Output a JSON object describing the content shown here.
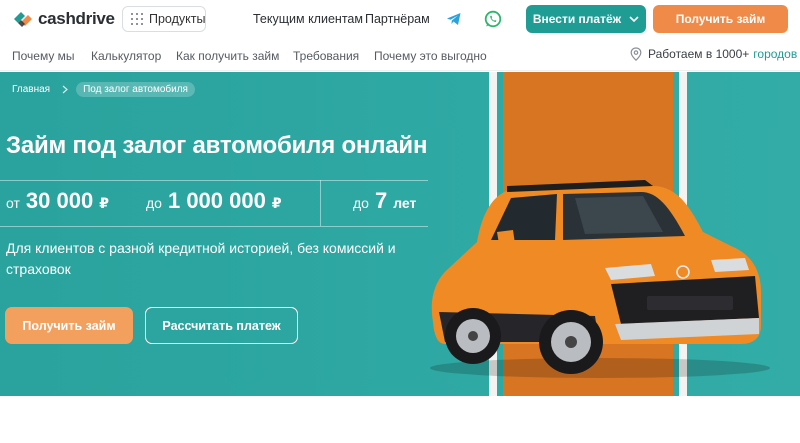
{
  "header": {
    "logo_text": "cashdrive",
    "products_label": "Продукты",
    "links": [
      "Текущим клиентам",
      "Партнёрам"
    ],
    "pay_button": "Внести платёж",
    "get_loan_button": "Получить займ",
    "icons": [
      "products-grid-icon",
      "telegram-icon",
      "whatsapp-icon",
      "chevron-down-icon"
    ],
    "colors": {
      "teal": "#1f9c94",
      "orange": "#f08a48",
      "telegram": "#29a3dc",
      "whatsapp": "#2bb66c"
    }
  },
  "subnav": {
    "items": [
      "Почему мы",
      "Калькулятор",
      "Как получить займ",
      "Требования",
      "Почему это выгодно"
    ],
    "geo_text": "Работаем в 1000+",
    "geo_link": "городов"
  },
  "hero": {
    "breadcrumb": [
      "Главная",
      "Под залог автомобиля"
    ],
    "title": "Займ под залог автомобиля онлайн",
    "stats": [
      {
        "prefix": "от",
        "value": "30 000",
        "unit": "₽"
      },
      {
        "prefix": "до",
        "value": "1 000 000",
        "unit": "₽"
      },
      {
        "prefix": "до",
        "value": "7",
        "unit": "лет"
      }
    ],
    "subtitle": "Для клиентов с разной кредитной историей, без комиссий и страховок",
    "primary_button": "Получить займ",
    "secondary_button": "Рассчитать платеж",
    "colors": {
      "background": "#2aa5a0",
      "stripe": "#d87523",
      "button": "#f3a05f"
    }
  }
}
